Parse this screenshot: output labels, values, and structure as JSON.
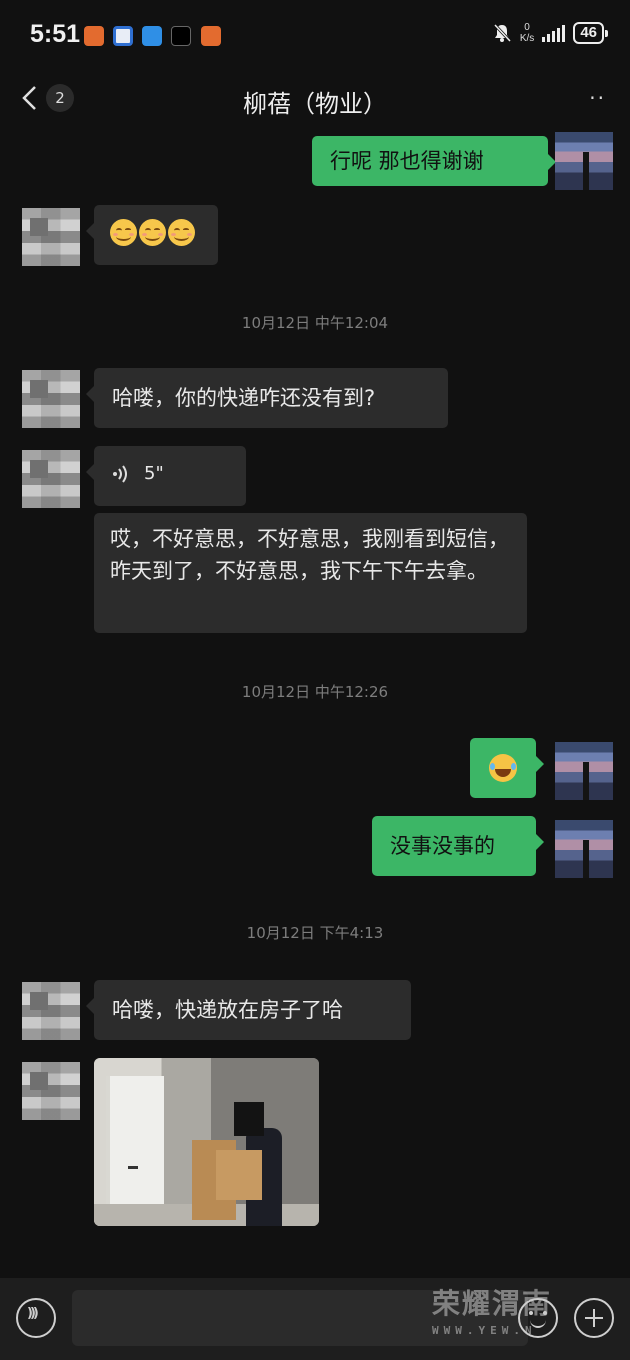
{
  "status_bar": {
    "time": "5:51",
    "app_icons": [
      "app-icon-orange",
      "app-icon-blue-ring",
      "app-icon-blue",
      "app-icon-dark",
      "app-icon-orange"
    ],
    "mute": "bell-off-icon",
    "net_speed_value": "0",
    "net_speed_unit": "K/s",
    "battery": "46"
  },
  "nav": {
    "back_badge": "2",
    "title": "柳蓓（物业）",
    "more_label": "··"
  },
  "messages": {
    "m1": "行呢   那也得谢谢",
    "m2_emoji_count": 3,
    "ts1": "10月12日 中午12:04",
    "m3": "哈喽，你的快递咋还没有到?",
    "m4_voice": "5\"",
    "m5": "哎，不好意思，不好意思，我刚看到短信，昨天到了，不好意思，我下午下午去拿。",
    "ts2": "10月12日 中午12:26",
    "m6_emoji": "joy-emoji",
    "m7": "没事没事的",
    "ts3": "10月12日  下午4:13",
    "m8": "哈喽，快递放在房子了哈",
    "m9_image": "delivery-photo"
  },
  "input_bar": {
    "placeholder": "",
    "voice_icon": "voice-icon",
    "emoji_icon": "emoji-icon",
    "plus_icon": "plus-icon"
  },
  "watermark": {
    "main": "荣耀渭南",
    "sub": "WWW.YEW.N"
  },
  "colors": {
    "background": "#111111",
    "incoming_bubble": "#2c2c2c",
    "outgoing_bubble": "#3cb666",
    "timestamp": "#7d7d7d"
  }
}
